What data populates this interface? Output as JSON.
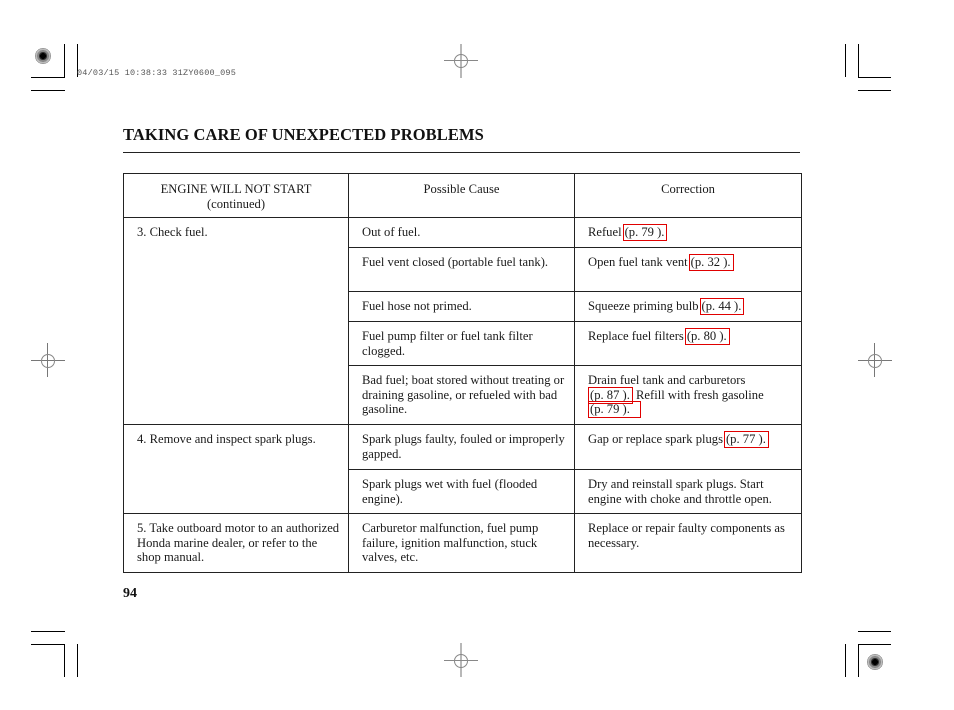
{
  "print_stamp": "04/03/15 10:38:33 31ZY0600_095",
  "section_title": "TAKING CARE OF UNEXPECTED PROBLEMS",
  "page_number": "94",
  "table": {
    "headers": {
      "col1_line1": "ENGINE WILL NOT START",
      "col1_line2": "(continued)",
      "col2": "Possible Cause",
      "col3": "Correction"
    },
    "steps": [
      {
        "step": "3. Check fuel.",
        "rows": [
          {
            "cause": "Out of fuel.",
            "correction_text": "Refuel",
            "ref": "(p. 79 ).",
            "correction_after": ""
          },
          {
            "cause": "Fuel vent closed (portable fuel tank).",
            "correction_text": "Open fuel tank vent",
            "ref": "(p. 32 ).",
            "correction_after": ""
          },
          {
            "cause": "Fuel hose not primed.",
            "correction_text": "Squeeze priming bulb",
            "ref": "(p. 44 ).",
            "correction_after": ""
          },
          {
            "cause": "Fuel pump filter or fuel tank filter clogged.",
            "correction_text": "Replace fuel filters",
            "ref": "(p. 80 ).",
            "correction_after": ""
          },
          {
            "cause": "Bad fuel; boat stored without treating or draining gasoline, or refueled with bad gasoline.",
            "correction_text": "Drain fuel tank and carburetors",
            "ref": "(p. 87 ).",
            "correction_after": "Refill with fresh gasoline",
            "ref2": "(p. 79 )."
          }
        ]
      },
      {
        "step": "4. Remove and inspect spark plugs.",
        "rows": [
          {
            "cause": "Spark plugs faulty, fouled or improperly gapped.",
            "correction_text": "Gap or replace spark plugs",
            "ref": "(p. 77 ).",
            "correction_after": ""
          },
          {
            "cause": "Spark plugs wet with fuel (flooded engine).",
            "correction_text": "Dry and reinstall spark plugs. Start engine with choke and throttle open.",
            "ref": "",
            "correction_after": ""
          }
        ]
      },
      {
        "step_num": "5.",
        "step_rest": "Take outboard motor to an authorized Honda marine dealer, or refer to the shop manual.",
        "rows": [
          {
            "cause": "Carburetor malfunction, fuel pump failure, ignition malfunction, stuck valves, etc.",
            "correction_text": "Replace or repair faulty components as necessary.",
            "ref": "",
            "correction_after": ""
          }
        ]
      }
    ]
  },
  "colors": {
    "link_box": "#e00000",
    "text": "#1a1a1a"
  }
}
